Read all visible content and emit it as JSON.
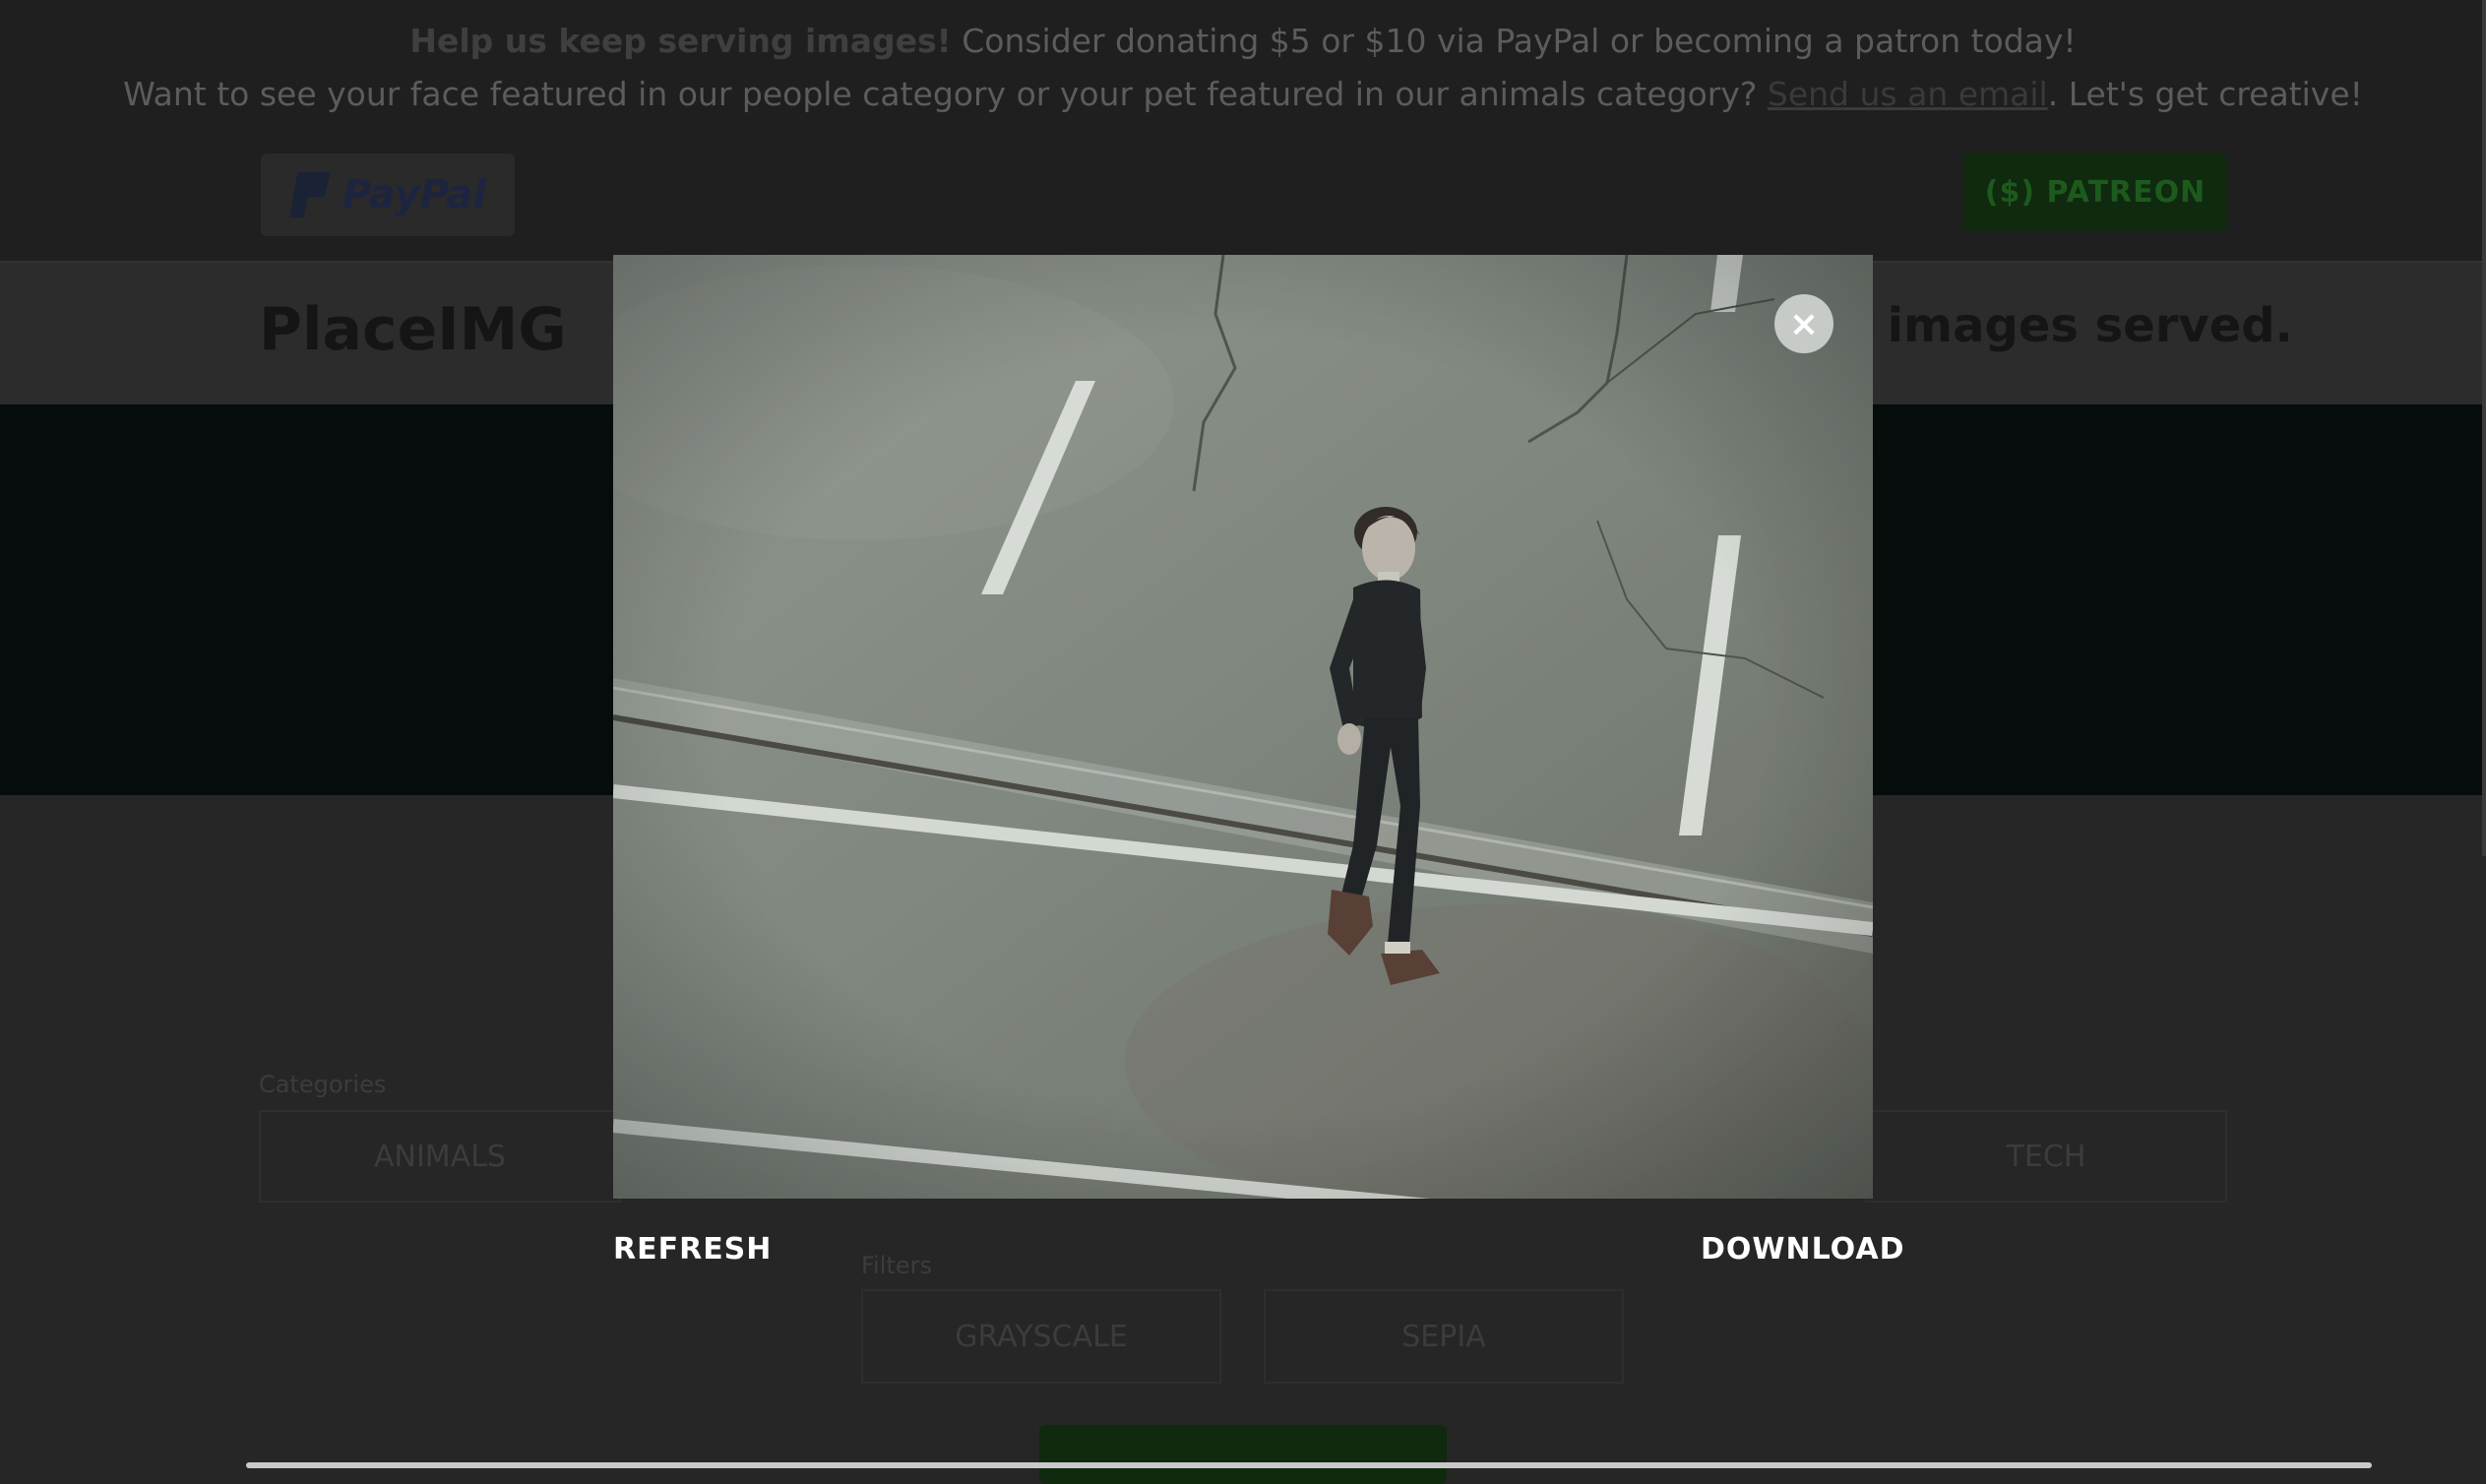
{
  "banner": {
    "line1_bold": "Help us keep serving images!",
    "line1_rest": " Consider donating $5 or $10 via PayPal or becoming a patron today!",
    "line2_pre": "Want to see your face featured in our people category or your pet featured in our animals category? ",
    "line2_link": "Send us an email",
    "line2_post": ". Let's get creative!",
    "paypal_label": "PayPal",
    "patreon_label": "($) PATREON"
  },
  "header": {
    "logo": "PlaceIMG",
    "served_text": "f images served."
  },
  "categories": {
    "label": "Categories",
    "first": "ANIMALS",
    "last": "TECH"
  },
  "filters": {
    "label": "Filters",
    "items": [
      "GRAYSCALE",
      "SEPIA"
    ]
  },
  "lightbox": {
    "close_symbol": "×",
    "refresh_label": "REFRESH",
    "download_label": "DOWNLOAD",
    "image_subject": "man in dark suit walking across a street"
  },
  "colors": {
    "overlay_background": "#262626",
    "patreon_green": "#0f2a0f",
    "action_text": "#ffffff"
  }
}
